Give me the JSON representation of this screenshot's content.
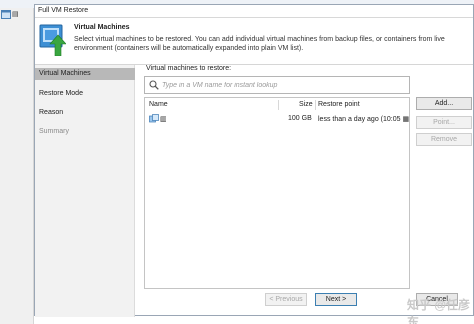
{
  "desktop": {
    "icon_label": "▤"
  },
  "window": {
    "title": "Full VM Restore"
  },
  "header": {
    "title": "Virtual Machines",
    "description": "Select virtual machines to be restored. You can add individual virtual machines from backup files, or containers from live environment (containers will be automatically expanded into plain VM list)."
  },
  "nav": {
    "items": [
      {
        "label": "Virtual Machines",
        "state": "active"
      },
      {
        "label": "Restore Mode",
        "state": "normal"
      },
      {
        "label": "Reason",
        "state": "normal"
      },
      {
        "label": "Summary",
        "state": "disabled"
      }
    ]
  },
  "main": {
    "vm_label": "Virtual machines to restore:",
    "search": {
      "placeholder": "Type in a VM name for instant lookup",
      "value": ""
    },
    "table": {
      "columns": [
        "Name",
        "Size",
        "Restore point"
      ],
      "rows": [
        {
          "name": "▥",
          "size": "100 GB",
          "restore_point": "less than a day ago (10:05 ▦"
        }
      ]
    }
  },
  "side_buttons": {
    "add": "Add...",
    "point": "Point...",
    "remove": "Remove"
  },
  "footer": {
    "previous": "< Previous",
    "next": "Next >",
    "cancel": "Cancel"
  },
  "watermark": {
    "text": "知乎 @任彦东"
  },
  "colors": {
    "accent_green": "#3aa640",
    "active_nav": "#b8b8b8",
    "header_icon_blue": "#2f7fc3"
  },
  "icons": {
    "search": "search-icon",
    "header": "vm-restore-icon",
    "vm": "vm-icon"
  }
}
